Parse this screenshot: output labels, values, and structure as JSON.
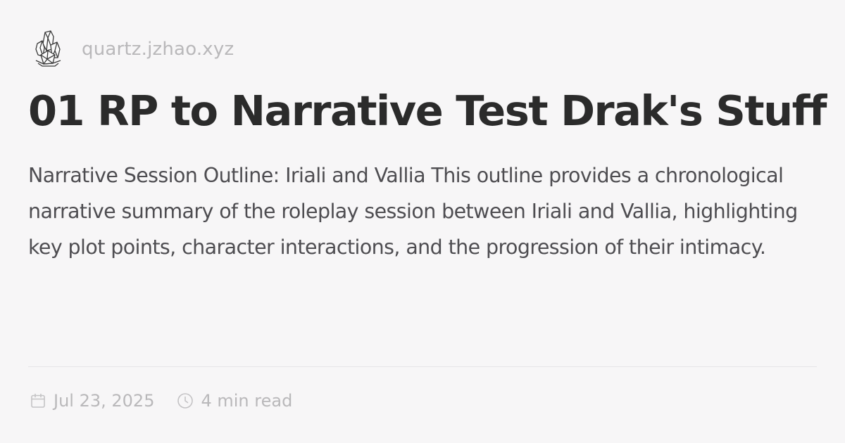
{
  "site": {
    "logo_icon": "crystal-cluster-icon",
    "url": "quartz.jzhao.xyz"
  },
  "page": {
    "title": "01 RP to Narrative Test Drak's Stuff",
    "description": "Narrative Session Outline: Iriali and Vallia This outline provides a chronological narrative summary of the roleplay session between Iriali and Vallia, highlighting key plot points, character interactions, and the progression of their intimacy."
  },
  "meta": {
    "date_icon": "calendar-icon",
    "date": "Jul 23, 2025",
    "reading_time_icon": "clock-icon",
    "reading_time": "4 min read"
  },
  "colors": {
    "background": "#f7f6f7",
    "title": "#2b2b2b",
    "body_text": "#4e4d51",
    "muted_text": "#b9b8ba",
    "divider": "#e6e4e7"
  }
}
